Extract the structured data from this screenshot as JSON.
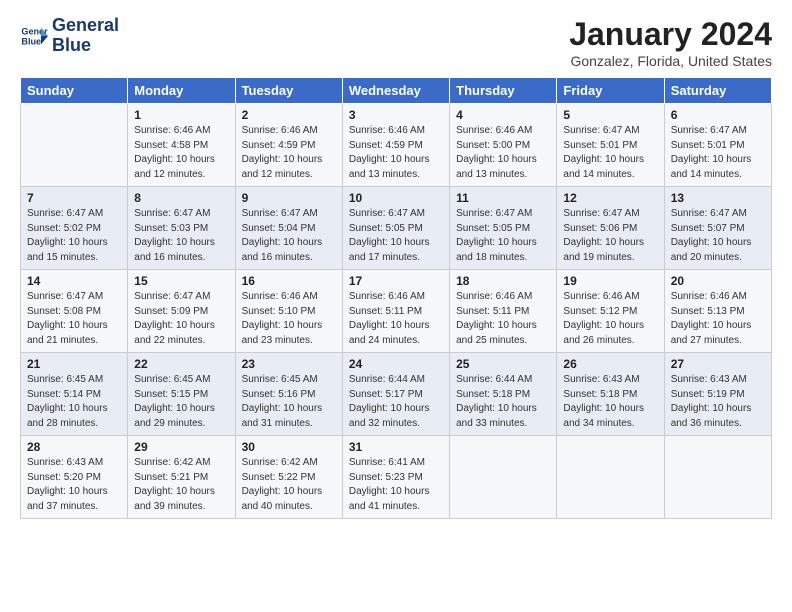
{
  "logo": {
    "line1": "General",
    "line2": "Blue"
  },
  "title": "January 2024",
  "location": "Gonzalez, Florida, United States",
  "days_of_week": [
    "Sunday",
    "Monday",
    "Tuesday",
    "Wednesday",
    "Thursday",
    "Friday",
    "Saturday"
  ],
  "weeks": [
    [
      {
        "num": "",
        "sunrise": "",
        "sunset": "",
        "daylight": ""
      },
      {
        "num": "1",
        "sunrise": "Sunrise: 6:46 AM",
        "sunset": "Sunset: 4:58 PM",
        "daylight": "Daylight: 10 hours and 12 minutes."
      },
      {
        "num": "2",
        "sunrise": "Sunrise: 6:46 AM",
        "sunset": "Sunset: 4:59 PM",
        "daylight": "Daylight: 10 hours and 12 minutes."
      },
      {
        "num": "3",
        "sunrise": "Sunrise: 6:46 AM",
        "sunset": "Sunset: 4:59 PM",
        "daylight": "Daylight: 10 hours and 13 minutes."
      },
      {
        "num": "4",
        "sunrise": "Sunrise: 6:46 AM",
        "sunset": "Sunset: 5:00 PM",
        "daylight": "Daylight: 10 hours and 13 minutes."
      },
      {
        "num": "5",
        "sunrise": "Sunrise: 6:47 AM",
        "sunset": "Sunset: 5:01 PM",
        "daylight": "Daylight: 10 hours and 14 minutes."
      },
      {
        "num": "6",
        "sunrise": "Sunrise: 6:47 AM",
        "sunset": "Sunset: 5:01 PM",
        "daylight": "Daylight: 10 hours and 14 minutes."
      }
    ],
    [
      {
        "num": "7",
        "sunrise": "Sunrise: 6:47 AM",
        "sunset": "Sunset: 5:02 PM",
        "daylight": "Daylight: 10 hours and 15 minutes."
      },
      {
        "num": "8",
        "sunrise": "Sunrise: 6:47 AM",
        "sunset": "Sunset: 5:03 PM",
        "daylight": "Daylight: 10 hours and 16 minutes."
      },
      {
        "num": "9",
        "sunrise": "Sunrise: 6:47 AM",
        "sunset": "Sunset: 5:04 PM",
        "daylight": "Daylight: 10 hours and 16 minutes."
      },
      {
        "num": "10",
        "sunrise": "Sunrise: 6:47 AM",
        "sunset": "Sunset: 5:05 PM",
        "daylight": "Daylight: 10 hours and 17 minutes."
      },
      {
        "num": "11",
        "sunrise": "Sunrise: 6:47 AM",
        "sunset": "Sunset: 5:05 PM",
        "daylight": "Daylight: 10 hours and 18 minutes."
      },
      {
        "num": "12",
        "sunrise": "Sunrise: 6:47 AM",
        "sunset": "Sunset: 5:06 PM",
        "daylight": "Daylight: 10 hours and 19 minutes."
      },
      {
        "num": "13",
        "sunrise": "Sunrise: 6:47 AM",
        "sunset": "Sunset: 5:07 PM",
        "daylight": "Daylight: 10 hours and 20 minutes."
      }
    ],
    [
      {
        "num": "14",
        "sunrise": "Sunrise: 6:47 AM",
        "sunset": "Sunset: 5:08 PM",
        "daylight": "Daylight: 10 hours and 21 minutes."
      },
      {
        "num": "15",
        "sunrise": "Sunrise: 6:47 AM",
        "sunset": "Sunset: 5:09 PM",
        "daylight": "Daylight: 10 hours and 22 minutes."
      },
      {
        "num": "16",
        "sunrise": "Sunrise: 6:46 AM",
        "sunset": "Sunset: 5:10 PM",
        "daylight": "Daylight: 10 hours and 23 minutes."
      },
      {
        "num": "17",
        "sunrise": "Sunrise: 6:46 AM",
        "sunset": "Sunset: 5:11 PM",
        "daylight": "Daylight: 10 hours and 24 minutes."
      },
      {
        "num": "18",
        "sunrise": "Sunrise: 6:46 AM",
        "sunset": "Sunset: 5:11 PM",
        "daylight": "Daylight: 10 hours and 25 minutes."
      },
      {
        "num": "19",
        "sunrise": "Sunrise: 6:46 AM",
        "sunset": "Sunset: 5:12 PM",
        "daylight": "Daylight: 10 hours and 26 minutes."
      },
      {
        "num": "20",
        "sunrise": "Sunrise: 6:46 AM",
        "sunset": "Sunset: 5:13 PM",
        "daylight": "Daylight: 10 hours and 27 minutes."
      }
    ],
    [
      {
        "num": "21",
        "sunrise": "Sunrise: 6:45 AM",
        "sunset": "Sunset: 5:14 PM",
        "daylight": "Daylight: 10 hours and 28 minutes."
      },
      {
        "num": "22",
        "sunrise": "Sunrise: 6:45 AM",
        "sunset": "Sunset: 5:15 PM",
        "daylight": "Daylight: 10 hours and 29 minutes."
      },
      {
        "num": "23",
        "sunrise": "Sunrise: 6:45 AM",
        "sunset": "Sunset: 5:16 PM",
        "daylight": "Daylight: 10 hours and 31 minutes."
      },
      {
        "num": "24",
        "sunrise": "Sunrise: 6:44 AM",
        "sunset": "Sunset: 5:17 PM",
        "daylight": "Daylight: 10 hours and 32 minutes."
      },
      {
        "num": "25",
        "sunrise": "Sunrise: 6:44 AM",
        "sunset": "Sunset: 5:18 PM",
        "daylight": "Daylight: 10 hours and 33 minutes."
      },
      {
        "num": "26",
        "sunrise": "Sunrise: 6:43 AM",
        "sunset": "Sunset: 5:18 PM",
        "daylight": "Daylight: 10 hours and 34 minutes."
      },
      {
        "num": "27",
        "sunrise": "Sunrise: 6:43 AM",
        "sunset": "Sunset: 5:19 PM",
        "daylight": "Daylight: 10 hours and 36 minutes."
      }
    ],
    [
      {
        "num": "28",
        "sunrise": "Sunrise: 6:43 AM",
        "sunset": "Sunset: 5:20 PM",
        "daylight": "Daylight: 10 hours and 37 minutes."
      },
      {
        "num": "29",
        "sunrise": "Sunrise: 6:42 AM",
        "sunset": "Sunset: 5:21 PM",
        "daylight": "Daylight: 10 hours and 39 minutes."
      },
      {
        "num": "30",
        "sunrise": "Sunrise: 6:42 AM",
        "sunset": "Sunset: 5:22 PM",
        "daylight": "Daylight: 10 hours and 40 minutes."
      },
      {
        "num": "31",
        "sunrise": "Sunrise: 6:41 AM",
        "sunset": "Sunset: 5:23 PM",
        "daylight": "Daylight: 10 hours and 41 minutes."
      },
      {
        "num": "",
        "sunrise": "",
        "sunset": "",
        "daylight": ""
      },
      {
        "num": "",
        "sunrise": "",
        "sunset": "",
        "daylight": ""
      },
      {
        "num": "",
        "sunrise": "",
        "sunset": "",
        "daylight": ""
      }
    ]
  ]
}
